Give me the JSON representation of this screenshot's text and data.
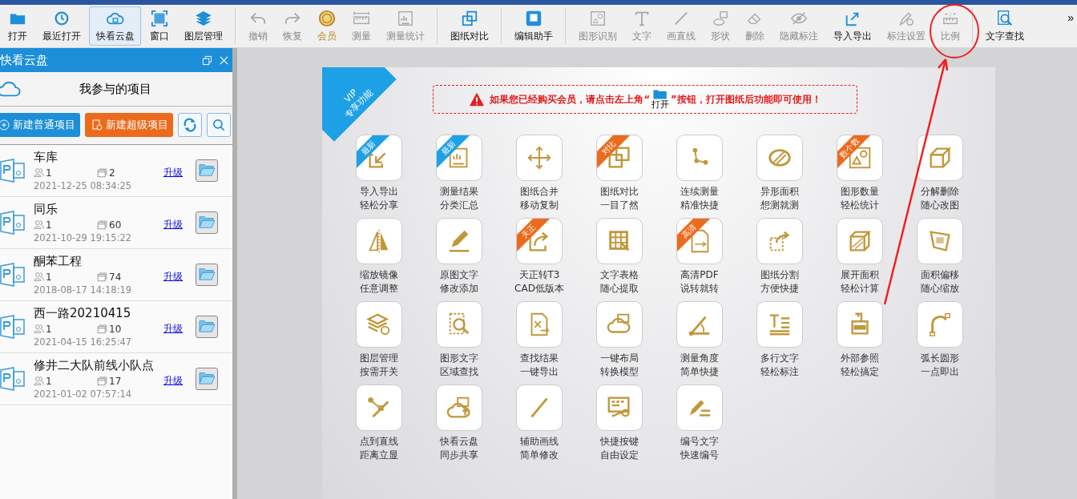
{
  "toolbar": {
    "items": [
      {
        "kind": "normal",
        "label": "打开",
        "selected": false
      },
      {
        "kind": "normal",
        "label": "最近打开",
        "selected": false
      },
      {
        "kind": "normal",
        "label": "快看云盘",
        "selected": true
      },
      {
        "kind": "normal",
        "label": "窗口",
        "selected": false
      },
      {
        "kind": "normal",
        "label": "图层管理",
        "selected": false
      },
      {
        "kind": "separator"
      },
      {
        "kind": "disabled",
        "label": "撤销",
        "selected": false
      },
      {
        "kind": "disabled",
        "label": "恢复",
        "selected": false
      },
      {
        "kind": "vip",
        "label": "会员",
        "selected": false
      },
      {
        "kind": "disabled",
        "label": "测量",
        "selected": false
      },
      {
        "kind": "disabled",
        "label": "测量统计",
        "selected": false
      },
      {
        "kind": "separator"
      },
      {
        "kind": "normal",
        "label": "图纸对比",
        "selected": false
      },
      {
        "kind": "separator"
      },
      {
        "kind": "normal",
        "label": "编辑助手",
        "selected": false
      },
      {
        "kind": "separator"
      },
      {
        "kind": "disabled",
        "label": "图形识别",
        "selected": false
      },
      {
        "kind": "disabled",
        "label": "文字",
        "selected": false
      },
      {
        "kind": "disabled",
        "label": "画直线",
        "selected": false
      },
      {
        "kind": "disabled",
        "label": "形状",
        "selected": false
      },
      {
        "kind": "disabled",
        "label": "删除",
        "selected": false
      },
      {
        "kind": "disabled",
        "label": "隐藏标注",
        "selected": false
      },
      {
        "kind": "normal",
        "label": "导入导出",
        "selected": false
      },
      {
        "kind": "disabled",
        "label": "标注设置",
        "selected": false
      },
      {
        "kind": "disabled",
        "label": "比例",
        "selected": false
      },
      {
        "kind": "separator"
      },
      {
        "kind": "normal",
        "label": "文字查找",
        "selected": false
      }
    ],
    "overflow": "»"
  },
  "sidebar": {
    "title": "快看云盘",
    "heading": "我参与的项目",
    "new_project_button": "新建普通项目",
    "new_super_project_button": "新建超级项目",
    "projects": [
      {
        "name": "车库",
        "members": "1",
        "files": "2",
        "link": "升级",
        "time": "2021-12-25 08:34:25"
      },
      {
        "name": "同乐",
        "members": "1",
        "files": "60",
        "link": "升级",
        "time": "2021-10-29 19:15:22"
      },
      {
        "name": "酮苯工程",
        "members": "1",
        "files": "74",
        "link": "升级",
        "time": "2018-08-17 14:18:19"
      },
      {
        "name": "西一路20210415",
        "members": "1",
        "files": "10",
        "link": "升级",
        "time": "2021-04-15 16:25:47"
      },
      {
        "name": "修井二大队前线小队点",
        "members": "1",
        "files": "17",
        "link": "升级",
        "time": "2021-01-02 07:57:14"
      }
    ]
  },
  "vip_panel": {
    "ribbon": [
      "VIP",
      "专享功能"
    ],
    "notice": {
      "before": "如果您已经购买会员，请点击左上角“",
      "button_label": "打开",
      "after": "”按钮，打开图纸后功能即可使用！"
    },
    "features": [
      {
        "lines": [
          "导入导出",
          "轻松分享"
        ],
        "badge": "最新",
        "color": "#1ea0e6"
      },
      {
        "lines": [
          "测量结果",
          "分类汇总"
        ],
        "badge": "最新",
        "color": "#1ea0e6"
      },
      {
        "lines": [
          "图纸合并",
          "移动复制"
        ]
      },
      {
        "lines": [
          "图纸对比",
          "一目了然"
        ],
        "badge": "对比",
        "color": "#ec6a1c"
      },
      {
        "lines": [
          "连续测量",
          "精准快捷"
        ]
      },
      {
        "lines": [
          "异形面积",
          "想测就测"
        ]
      },
      {
        "lines": [
          "图形数量",
          "轻松统计"
        ],
        "badge": "数个数",
        "color": "#ec6a1c"
      },
      {
        "lines": [
          "分解删除",
          "随心改图"
        ]
      },
      {
        "lines": [
          "缩放镜像",
          "任意调整"
        ]
      },
      {
        "lines": [
          "原图文字",
          "修改添加"
        ]
      },
      {
        "lines": [
          "天正转T3",
          "CAD低版本"
        ],
        "badge": "天正",
        "color": "#ec6a1c"
      },
      {
        "lines": [
          "文字表格",
          "随心提取"
        ]
      },
      {
        "lines": [
          "高清PDF",
          "说转就转"
        ],
        "badge": "高清",
        "color": "#ec6a1c"
      },
      {
        "lines": [
          "图纸分割",
          "方便快捷"
        ]
      },
      {
        "lines": [
          "展开面积",
          "轻松计算"
        ]
      },
      {
        "lines": [
          "面积偏移",
          "随心缩放"
        ]
      },
      {
        "lines": [
          "图层管理",
          "按需开关"
        ]
      },
      {
        "lines": [
          "图形文字",
          "区域查找"
        ]
      },
      {
        "lines": [
          "查找结果",
          "一键导出"
        ]
      },
      {
        "lines": [
          "一键布局",
          "转换模型"
        ]
      },
      {
        "lines": [
          "测量角度",
          "简单快捷"
        ]
      },
      {
        "lines": [
          "多行文字",
          "轻松标注"
        ]
      },
      {
        "lines": [
          "外部参照",
          "轻松搞定"
        ]
      },
      {
        "lines": [
          "弧长圆形",
          "一点即出"
        ]
      },
      {
        "lines": [
          "点到直线",
          "距离立显"
        ]
      },
      {
        "lines": [
          "快看云盘",
          "同步共享"
        ]
      },
      {
        "lines": [
          "辅助画线",
          "简单修改"
        ]
      },
      {
        "lines": [
          "快捷按键",
          "自由设定"
        ]
      },
      {
        "lines": [
          "编号文字",
          "快速编号"
        ]
      }
    ]
  }
}
